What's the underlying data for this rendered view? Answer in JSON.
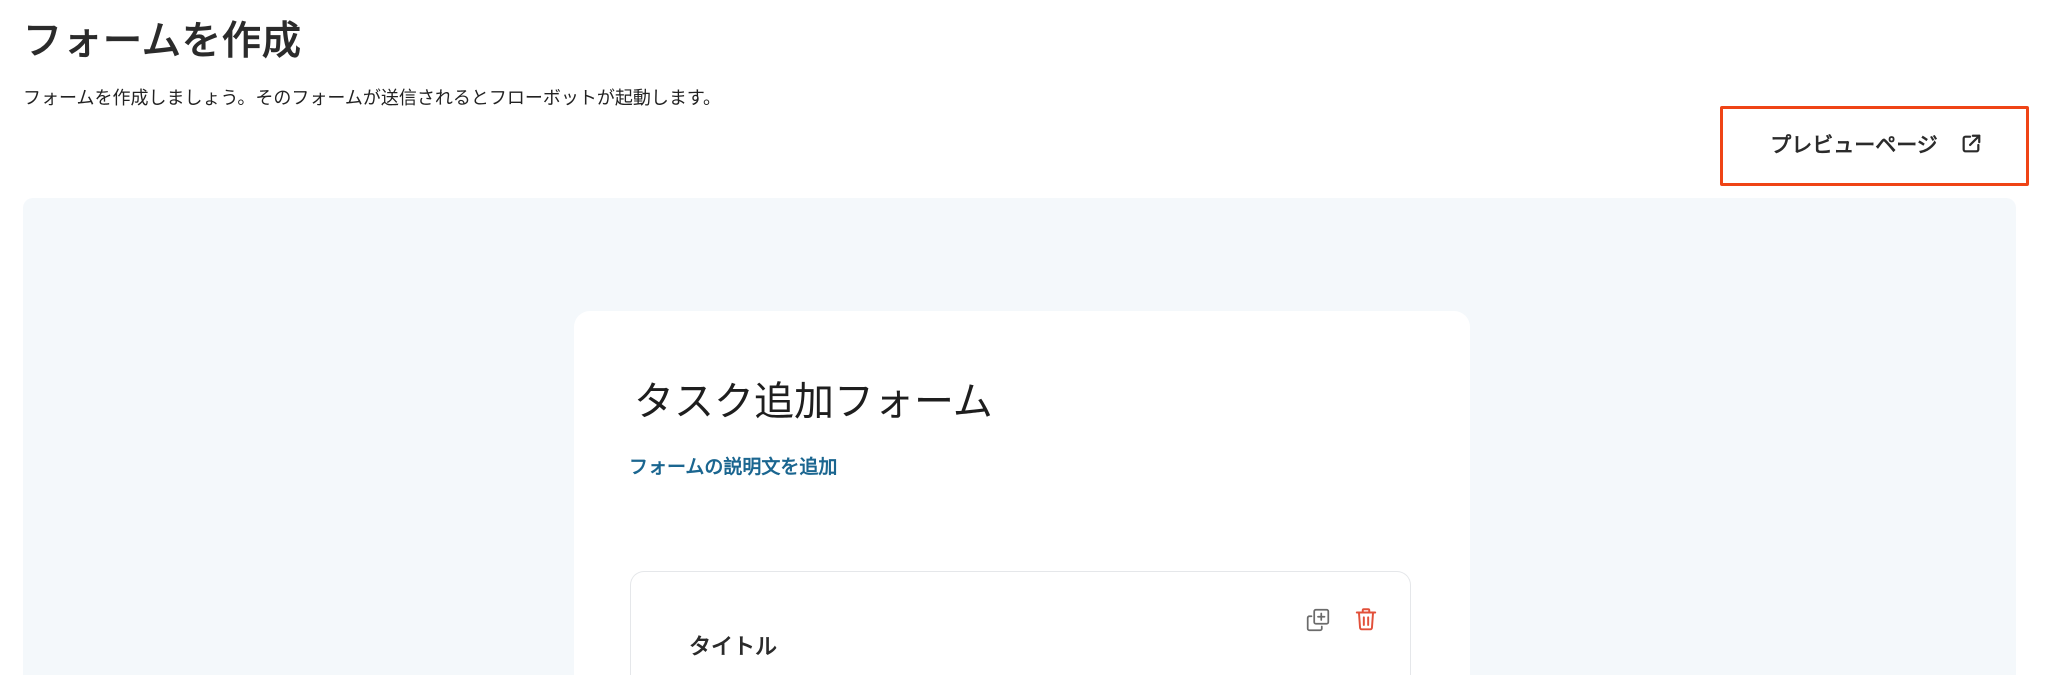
{
  "header": {
    "title": "フォームを作成",
    "subtitle": "フォームを作成しましょう。そのフォームが送信されるとフローボットが起動します。"
  },
  "preview": {
    "label": "プレビューページ",
    "icon": "external-link-icon"
  },
  "form": {
    "title": "タスク追加フォーム",
    "add_description_link": "フォームの説明文を追加",
    "fields": [
      {
        "label": "タイトル",
        "actions": [
          "duplicate-icon",
          "trash-icon"
        ]
      }
    ]
  },
  "colors": {
    "highlight": "#ef4416",
    "link": "#1b6690",
    "canvas_background": "#f4f8fb",
    "delete_icon": "#e2503a",
    "duplicate_icon": "#6b6b6b"
  }
}
